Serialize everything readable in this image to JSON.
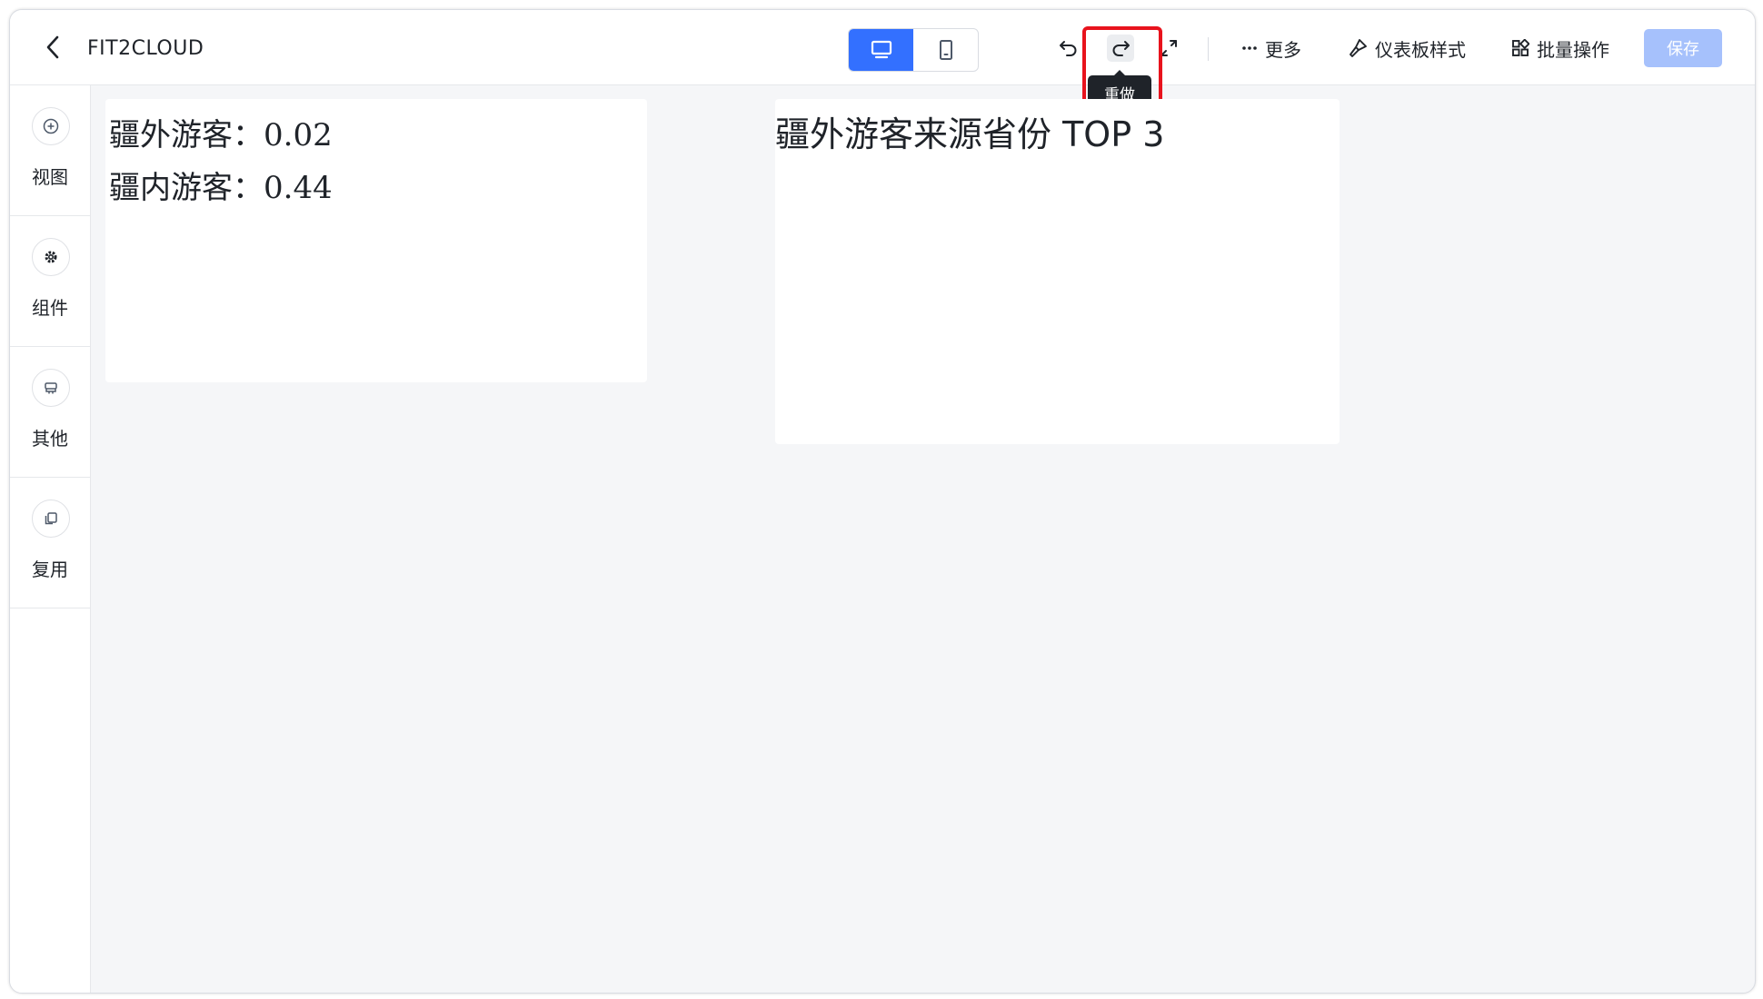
{
  "header": {
    "title": "FIT2CLOUD",
    "more_label": "更多",
    "style_label": "仪表板样式",
    "batch_label": "批量操作",
    "save_label": "保存",
    "tooltip": "重做"
  },
  "sidebar": {
    "items": [
      {
        "label": "视图",
        "icon": "plus-circle-icon"
      },
      {
        "label": "组件",
        "icon": "gear-icon"
      },
      {
        "label": "其他",
        "icon": "stack-icon"
      },
      {
        "label": "复用",
        "icon": "copy-icon"
      }
    ]
  },
  "canvas": {
    "stats": [
      {
        "label": "疆外游客：",
        "value": "0.02"
      },
      {
        "label": "疆内游客：",
        "value": "0.44"
      }
    ],
    "chart_title": "疆外游客来源省份 TOP 3"
  },
  "colors": {
    "accent": "#3370ff",
    "save_disabled": "#a6c1fc",
    "highlight": "#e8131d",
    "canvas_bg": "#f5f6f8"
  }
}
